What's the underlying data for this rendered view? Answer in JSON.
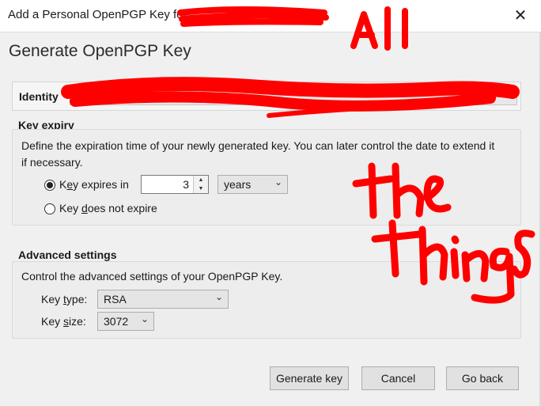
{
  "window": {
    "title": "Add a Personal OpenPGP Key for",
    "close_label": "✕"
  },
  "heading": "Generate OpenPGP Key",
  "identity": {
    "label": "Identity"
  },
  "key_expiry": {
    "title": "Key expiry",
    "description": "Define the expiration time of your newly generated key. You can later control the date to extend it if necessary.",
    "option_expires_prefix": "K",
    "option_expires_underline": "e",
    "option_expires_rest": "y expires in",
    "option_no_expire_prefix": "Key ",
    "option_no_expire_underline": "d",
    "option_no_expire_rest": "oes not expire",
    "expires_value": "3",
    "unit_value": "years",
    "selected": "expires"
  },
  "advanced": {
    "title": "Advanced settings",
    "description": "Control the advanced settings of your OpenPGP Key.",
    "key_type_label_prefix": "Key ",
    "key_type_label_underline": "t",
    "key_type_label_rest": "ype:",
    "key_type_value": "RSA",
    "key_size_label_prefix": "Key ",
    "key_size_label_underline": "s",
    "key_size_label_rest": "ize:",
    "key_size_value": "3072"
  },
  "buttons": {
    "generate": "Generate key",
    "cancel": "Cancel",
    "go_back": "Go back"
  },
  "annotation_color": "#ff0000"
}
